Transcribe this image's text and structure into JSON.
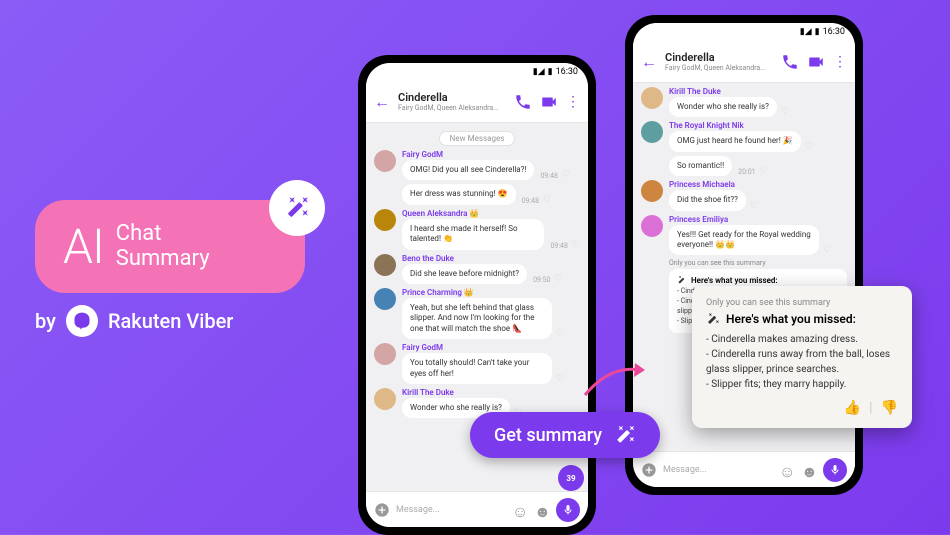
{
  "promo": {
    "ai": "AI",
    "line1": "Chat",
    "line2": "Summary",
    "by": "by",
    "brand": "Rakuten Viber"
  },
  "status": {
    "time": "16:30"
  },
  "header": {
    "name": "Cinderella",
    "sub": "Fairy GodM, Queen Aleksandra..."
  },
  "newMessages": "New Messages",
  "messages_phone1": [
    {
      "sender": "Fairy GodM",
      "text": "OMG! Did you all see Cinderella?!",
      "time": "09:48",
      "av": "av1"
    },
    {
      "sender": "",
      "text": "Her dress was stunning! 😍",
      "time": "09:48",
      "av": ""
    },
    {
      "sender": "Queen Aleksandra 👑",
      "text": "I heard she made it herself! So talented! 👏",
      "time": "09:48",
      "av": "av2"
    },
    {
      "sender": "Beno the Duke",
      "text": "Did she leave before midnight?",
      "time": "09:50",
      "av": "av3"
    },
    {
      "sender": "Prince Charming 👑",
      "text": "Yeah, but she left behind that glass slipper. And now I'm looking for the one that will match the shoe 👠",
      "time": "",
      "av": "av4"
    },
    {
      "sender": "Fairy GodM",
      "text": "You totally should! Can't take your eyes off her!",
      "time": "",
      "av": "av1"
    },
    {
      "sender": "Kirill The Duke",
      "text": "Wonder who she really is?",
      "time": "",
      "av": "av5"
    }
  ],
  "messages_phone2": [
    {
      "sender": "Kirill The Duke",
      "text": "Wonder who she really is?",
      "time": "",
      "av": "av5"
    },
    {
      "sender": "The Royal Knight Nik",
      "text": "OMG just heard he found her! 🎉",
      "time": "",
      "av": "av6"
    },
    {
      "sender": "",
      "text": "So romantic!!",
      "time": "20:01",
      "av": ""
    },
    {
      "sender": "Princess Michaela",
      "text": "Did the shoe fit??",
      "time": "",
      "av": "av7"
    },
    {
      "sender": "Princess Emiliya",
      "text": "Yes!!! Get ready for the Royal wedding everyone!! 👑👑",
      "time": "",
      "av": "av8"
    }
  ],
  "summary_inline": {
    "label": "Only you can see this summary",
    "title": "Here's what you missed:",
    "lines": "- Cinderella makes amazing dress.\n- Cinderella runs away from the ball, loses glass slipper, prince searches.\n- Slipper fits; they marry happily."
  },
  "getSummary": "Get summary",
  "popup": {
    "label": "Only you can see this summary",
    "title": "Here's what you missed:",
    "body": "- Cinderella makes amazing dress.\n- Cinderella runs away from the ball, loses glass slipper, prince searches.\n- Slipper fits; they marry happily."
  },
  "input": {
    "placeholder": "Message..."
  },
  "scrollCount": "39"
}
